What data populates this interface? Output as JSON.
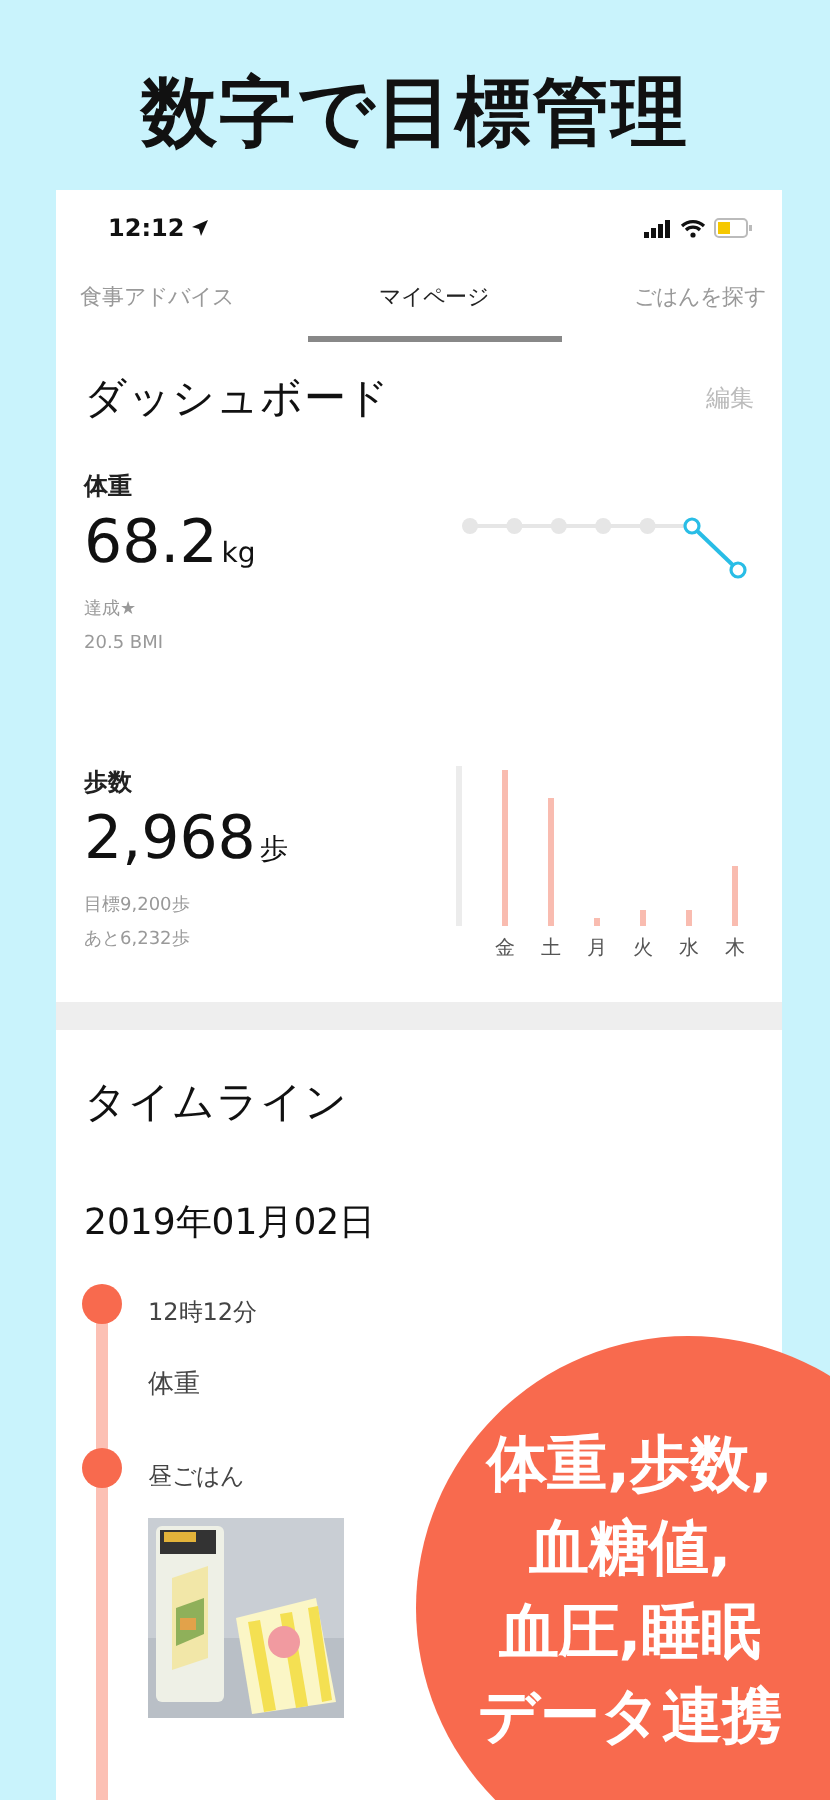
{
  "headline": "数字で目標管理",
  "status_bar": {
    "time": "12:12"
  },
  "tabs": [
    {
      "label": "食事アドバイス",
      "selected": false
    },
    {
      "label": "マイページ",
      "selected": true
    },
    {
      "label": "ごはんを探す",
      "selected": false
    }
  ],
  "dashboard": {
    "title": "ダッシュボード",
    "edit": "編集",
    "weight": {
      "label": "体重",
      "value": "68.2",
      "unit": "kg",
      "notes": [
        "達成★",
        "20.5 BMI"
      ]
    },
    "steps": {
      "label": "歩数",
      "value": "2,968",
      "unit": "歩",
      "notes": [
        "目標9,200歩",
        "あと6,232歩"
      ],
      "day_labels": [
        "金",
        "土",
        "月",
        "火",
        "水",
        "木"
      ]
    }
  },
  "timeline": {
    "title": "タイムライン",
    "date": "2019年01月02日",
    "entries": [
      {
        "kind": "text",
        "title": "12時12分",
        "text": "体重"
      },
      {
        "title": "昼ごはん"
      }
    ]
  },
  "promo": {
    "lines": [
      "体重,歩数,",
      "血糖値,",
      "血圧,睡眠",
      "データ連携"
    ]
  }
}
